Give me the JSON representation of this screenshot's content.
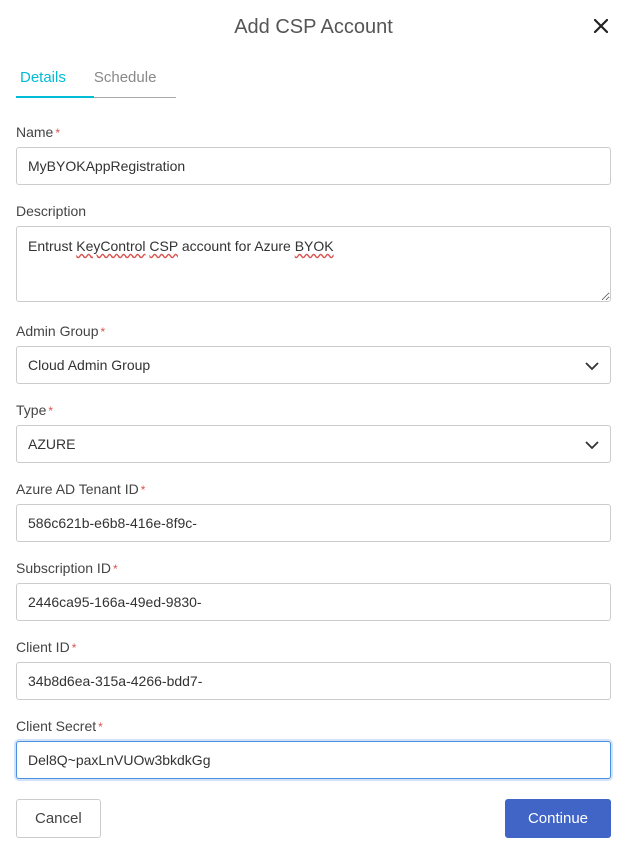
{
  "dialog": {
    "title": "Add CSP Account"
  },
  "tabs": {
    "details": "Details",
    "schedule": "Schedule"
  },
  "form": {
    "name_label": "Name",
    "name_value": "MyBYOKAppRegistration",
    "description_label": "Description",
    "description_value": "Entrust KeyControl CSP account for Azure BYOK",
    "description_words": {
      "w0": "Entrust",
      "w1": "KeyControl",
      "w2": "CSP",
      "w3": "account",
      "w4": "for",
      "w5": "Azure",
      "w6": "BYOK"
    },
    "admin_group_label": "Admin Group",
    "admin_group_value": "Cloud Admin Group",
    "type_label": "Type",
    "type_value": "AZURE",
    "tenant_id_label": "Azure AD Tenant ID",
    "tenant_id_value": "586c621b-e6b8-416e-8f9c-",
    "subscription_id_label": "Subscription ID",
    "subscription_id_value": "2446ca95-166a-49ed-9830-",
    "client_id_label": "Client ID",
    "client_id_value": "34b8d6ea-315a-4266-bdd7-",
    "client_secret_label": "Client Secret",
    "client_secret_value": "Del8Q~paxLnVUOw3bkdkGg"
  },
  "buttons": {
    "cancel": "Cancel",
    "continue": "Continue"
  }
}
